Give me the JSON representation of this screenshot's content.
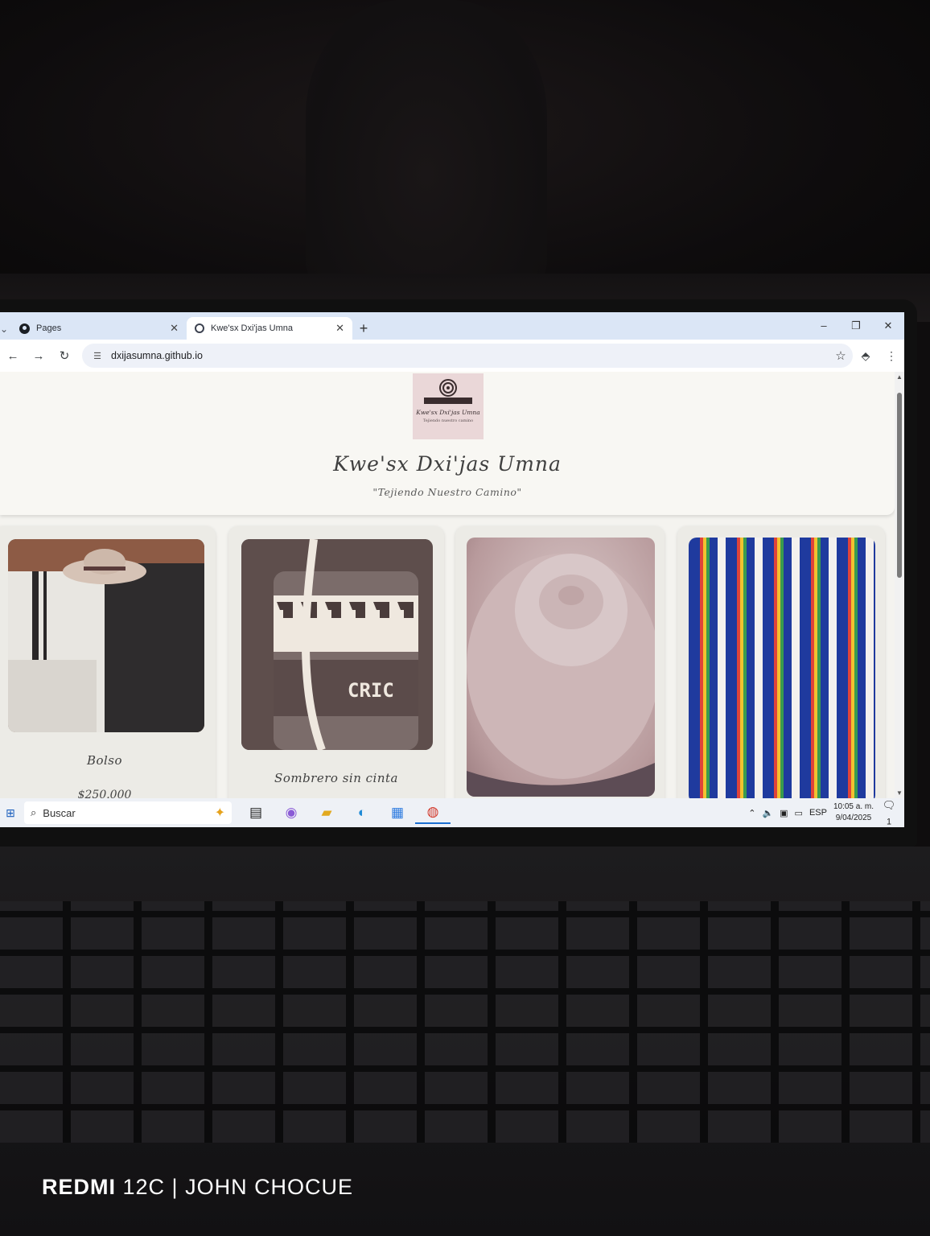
{
  "browser": {
    "tabs": [
      {
        "label": "Pages",
        "icon": "github-icon",
        "active": false
      },
      {
        "label": "Kwe'sx Dxi'jas Umna",
        "icon": "globe-icon",
        "active": true
      }
    ],
    "new_tab_glyph": "+",
    "window_controls": {
      "minimize": "–",
      "restore": "❐",
      "close": "✕"
    },
    "address": "dxijasumna.github.io"
  },
  "site": {
    "logo_name": "Kwe'sx Dxi'jas Umna",
    "logo_tagline": "Tejiendo nuestro camino",
    "title": "Kwe'sx Dxi'jas Umna",
    "tagline": "\"Tejiendo Nuestro Camino\""
  },
  "products": [
    {
      "title": "Bolso",
      "price": "$250.000",
      "photo": "poncho-and-hat-photo"
    },
    {
      "title": "Sombrero sin cinta",
      "price": "",
      "photo": "woven-bag-photo"
    },
    {
      "title": "",
      "price": "",
      "photo": "straw-hat-photo"
    },
    {
      "title": "",
      "price": "",
      "photo": "woven-belts-photo"
    }
  ],
  "product_photo_text": {
    "bag_weave_text": "CRIC"
  },
  "taskbar": {
    "search_placeholder": "Buscar",
    "language": "ESP",
    "time": "10:05 a. m.",
    "date": "9/04/2025",
    "notification_count": "1"
  },
  "watermark": {
    "brand": "REDMI",
    "text": "12C | JOHN CHOCUE"
  },
  "colors": {
    "tab_bar": "#dbe6f6",
    "logo_bg": "#ead7d8",
    "page_bg": "#f4f3ef",
    "taskbar": "#eef1f6"
  }
}
